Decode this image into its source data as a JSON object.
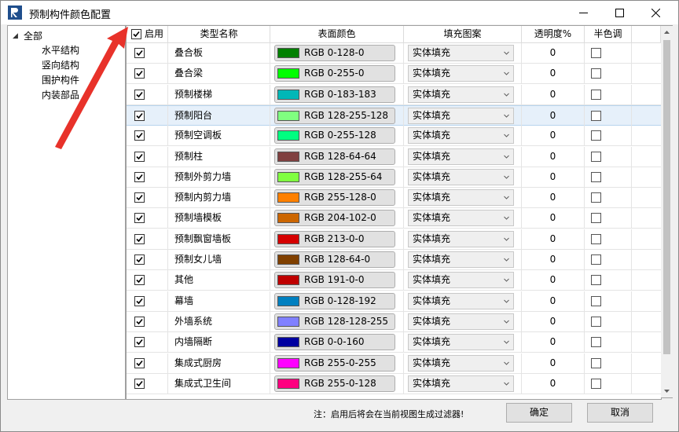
{
  "window": {
    "title": "预制构件颜色配置",
    "minimize_icon": "minimize-icon",
    "maximize_icon": "maximize-icon",
    "close_icon": "close-icon"
  },
  "tree": {
    "root": "全部",
    "children": [
      "水平结构",
      "竖向结构",
      "围护构件",
      "内装部品"
    ]
  },
  "columns": {
    "enable": "启用",
    "type_name": "类型名称",
    "surface_color": "表面颜色",
    "fill_pattern": "填充图案",
    "transparency": "透明度%",
    "halftone": "半色调"
  },
  "header_enable_checked": true,
  "selected_row_index": 3,
  "rows": [
    {
      "enabled": true,
      "name": "叠合板",
      "color_hex": "#008000",
      "color_label": "RGB  0-128-0",
      "fill": "实体填充",
      "transparency": "0",
      "halftone": false
    },
    {
      "enabled": true,
      "name": "叠合梁",
      "color_hex": "#00ff00",
      "color_label": "RGB  0-255-0",
      "fill": "实体填充",
      "transparency": "0",
      "halftone": false
    },
    {
      "enabled": true,
      "name": "预制楼梯",
      "color_hex": "#00b7b7",
      "color_label": "RGB  0-183-183",
      "fill": "实体填充",
      "transparency": "0",
      "halftone": false
    },
    {
      "enabled": true,
      "name": "预制阳台",
      "color_hex": "#80ff80",
      "color_label": "RGB  128-255-128",
      "fill": "实体填充",
      "transparency": "0",
      "halftone": false
    },
    {
      "enabled": true,
      "name": "预制空调板",
      "color_hex": "#00ff80",
      "color_label": "RGB  0-255-128",
      "fill": "实体填充",
      "transparency": "0",
      "halftone": false
    },
    {
      "enabled": true,
      "name": "预制柱",
      "color_hex": "#804040",
      "color_label": "RGB  128-64-64",
      "fill": "实体填充",
      "transparency": "0",
      "halftone": false
    },
    {
      "enabled": true,
      "name": "预制外剪力墙",
      "color_hex": "#80ff40",
      "color_label": "RGB  128-255-64",
      "fill": "实体填充",
      "transparency": "0",
      "halftone": false
    },
    {
      "enabled": true,
      "name": "预制内剪力墙",
      "color_hex": "#ff8000",
      "color_label": "RGB  255-128-0",
      "fill": "实体填充",
      "transparency": "0",
      "halftone": false
    },
    {
      "enabled": true,
      "name": "预制墙模板",
      "color_hex": "#cc6600",
      "color_label": "RGB  204-102-0",
      "fill": "实体填充",
      "transparency": "0",
      "halftone": false
    },
    {
      "enabled": true,
      "name": "预制飘窗墙板",
      "color_hex": "#d50000",
      "color_label": "RGB  213-0-0",
      "fill": "实体填充",
      "transparency": "0",
      "halftone": false
    },
    {
      "enabled": true,
      "name": "预制女儿墙",
      "color_hex": "#804000",
      "color_label": "RGB  128-64-0",
      "fill": "实体填充",
      "transparency": "0",
      "halftone": false
    },
    {
      "enabled": true,
      "name": "其他",
      "color_hex": "#bf0000",
      "color_label": "RGB  191-0-0",
      "fill": "实体填充",
      "transparency": "0",
      "halftone": false
    },
    {
      "enabled": true,
      "name": "幕墙",
      "color_hex": "#0080c0",
      "color_label": "RGB  0-128-192",
      "fill": "实体填充",
      "transparency": "0",
      "halftone": false
    },
    {
      "enabled": true,
      "name": "外墙系统",
      "color_hex": "#8080ff",
      "color_label": "RGB  128-128-255",
      "fill": "实体填充",
      "transparency": "0",
      "halftone": false
    },
    {
      "enabled": true,
      "name": "内墙隔断",
      "color_hex": "#0000a0",
      "color_label": "RGB  0-0-160",
      "fill": "实体填充",
      "transparency": "0",
      "halftone": false
    },
    {
      "enabled": true,
      "name": "集成式厨房",
      "color_hex": "#ff00ff",
      "color_label": "RGB  255-0-255",
      "fill": "实体填充",
      "transparency": "0",
      "halftone": false
    },
    {
      "enabled": true,
      "name": "集成式卫生间",
      "color_hex": "#ff0080",
      "color_label": "RGB  255-0-128",
      "fill": "实体填充",
      "transparency": "0",
      "halftone": false
    }
  ],
  "footer": {
    "note": "注：启用后将会在当前视图生成过滤器!",
    "ok": "确定",
    "cancel": "取消"
  },
  "annotation_color": "#e8322a"
}
